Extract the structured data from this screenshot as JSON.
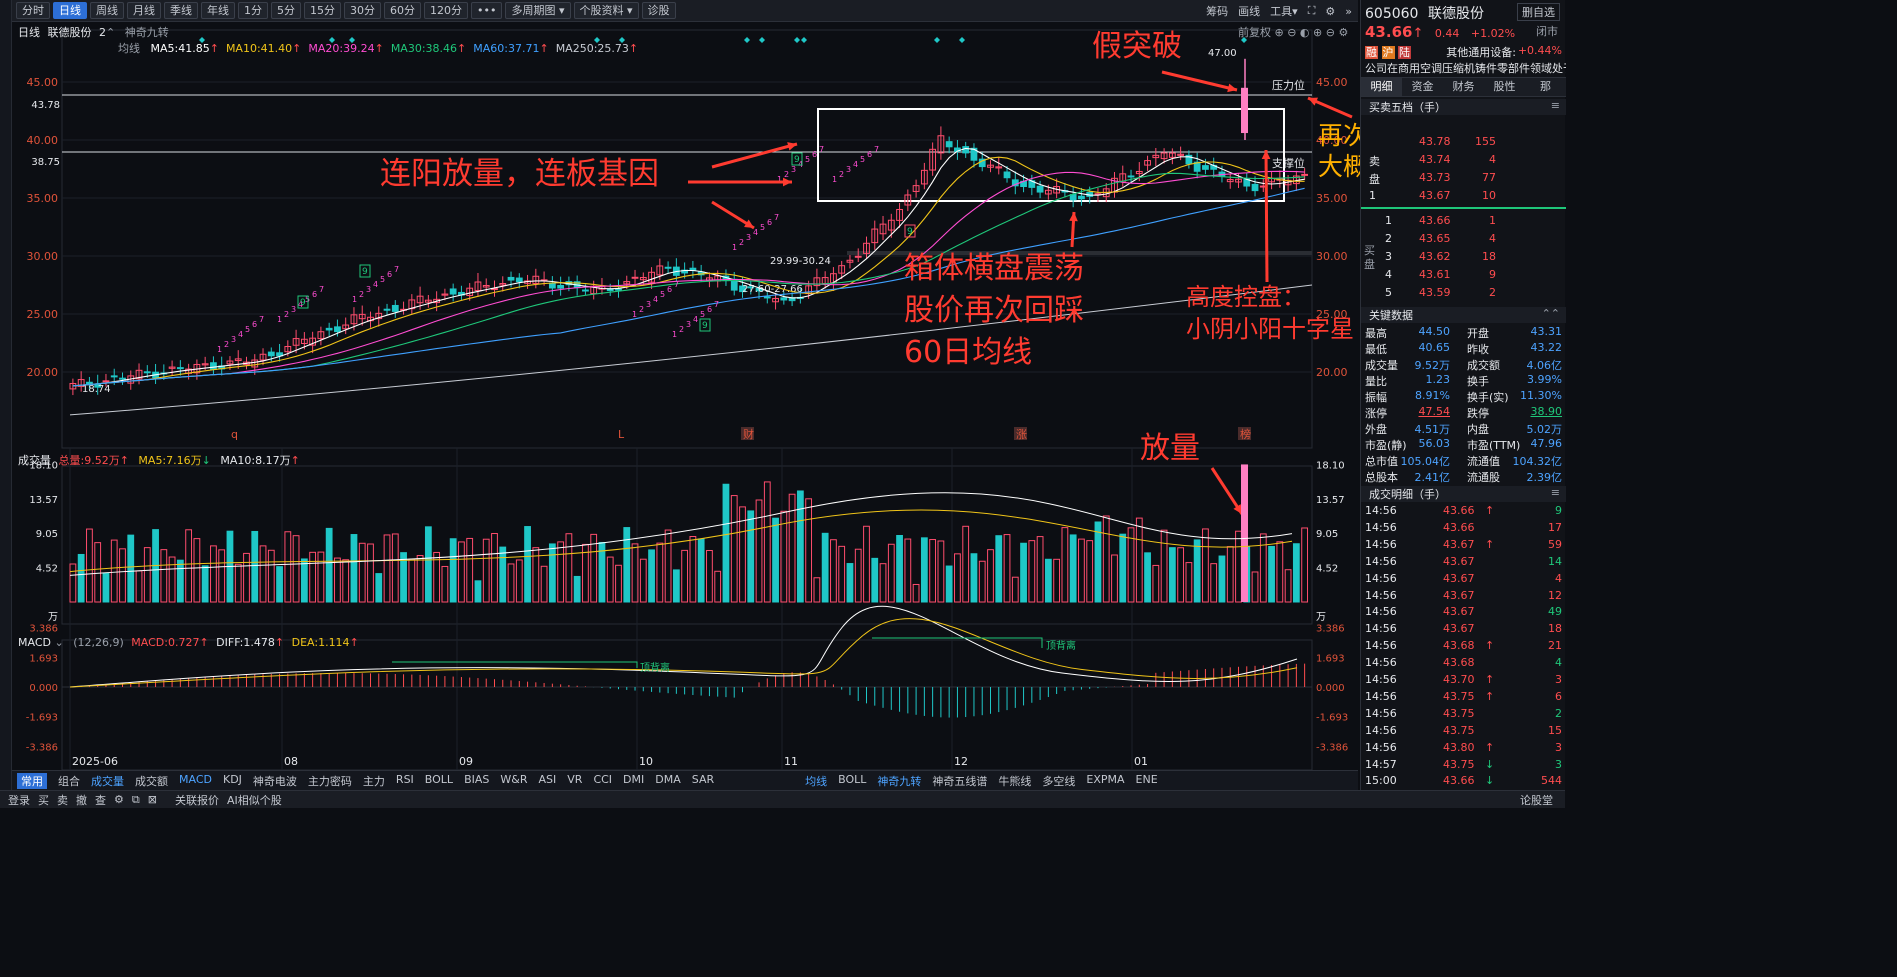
{
  "toolbar": {
    "periods": [
      "分时",
      "日线",
      "周线",
      "月线",
      "季线",
      "年线",
      "1分",
      "5分",
      "15分",
      "30分",
      "60分",
      "120分",
      "•••"
    ],
    "active": "日线",
    "multi": "多周期图",
    "info": "个股资料",
    "diag": "诊股",
    "tools": [
      "筹码",
      "画线",
      "工具"
    ]
  },
  "header": {
    "period": "日线",
    "stock": "联德股份",
    "count": "2",
    "indicator": "神奇九转",
    "fq": "前复权",
    "ma_label": "均线",
    "ma": [
      {
        "t": "MA5:41.85",
        "c": "#ffffff"
      },
      {
        "t": "MA10:41.40",
        "c": "#f0c419"
      },
      {
        "t": "MA20:39.24",
        "c": "#ff4dd2"
      },
      {
        "t": "MA30:38.46",
        "c": "#1fc77a"
      },
      {
        "t": "MA60:37.71",
        "c": "#3fa0ff"
      },
      {
        "t": "MA250:25.73",
        "c": "#c8ccd4"
      }
    ]
  },
  "yaxis": {
    "labels": [
      "45.00",
      "40.00",
      "35.00",
      "30.00",
      "25.00",
      "20.00"
    ],
    "left_ref1": "43.78",
    "left_ref2": "38.75",
    "hi": "47.00",
    "range1": "29.99-30.24",
    "range2": "27.60-27.66",
    "lo": "18.74",
    "press": "压力位",
    "support": "支撑位"
  },
  "xaxis": {
    "labels": [
      "2025-06",
      "08",
      "09",
      "10",
      "11",
      "12",
      "01"
    ]
  },
  "markers": {
    "q": "q",
    "L": "L",
    "cai": "财",
    "zhang": "涨",
    "bang": "榜"
  },
  "nine": {
    "digits": [
      "1",
      "2",
      "3",
      "4",
      "5",
      "6",
      "7",
      "8",
      "9"
    ]
  },
  "volume": {
    "label": "成交量",
    "total": "总量:9.52万",
    "ma5": "MA5:7.16万",
    "ma10": "MA10:8.17万",
    "ticks": [
      "18.10",
      "13.57",
      "9.05",
      "4.52",
      "万"
    ]
  },
  "macd": {
    "label": "MACD",
    "params": "(12,26,9)",
    "macd": "MACD:0.727",
    "diff": "DIFF:1.478",
    "dea": "DEA:1.114",
    "ticks": [
      "3.386",
      "1.693",
      "0.000",
      "-1.693",
      "-3.386"
    ],
    "div": "顶背离"
  },
  "indicators": {
    "tabs": [
      "常用",
      "组合",
      "成交量",
      "成交额",
      "MACD",
      "KDJ",
      "神奇电波",
      "主力密码",
      "主力",
      "RSI",
      "BOLL",
      "BIAS",
      "W&R",
      "ASI",
      "VR",
      "CCI",
      "DMI",
      "DMA",
      "SAR"
    ],
    "right": [
      "均线",
      "BOLL",
      "神奇九转",
      "神奇五线谱",
      "牛熊线",
      "多空线",
      "EXPMA",
      "ENE"
    ]
  },
  "status": {
    "items": [
      "登录",
      "买",
      "卖",
      "撤",
      "查"
    ],
    "tabs": [
      "关联报价",
      "AI相似个股"
    ],
    "right": "论股堂"
  },
  "annotations": {
    "a1": "假突破",
    "a2": "连阳放量，连板基因",
    "a3": "箱体横盘震荡",
    "a4": "股价再次回踩",
    "a5": "60日均线",
    "a6": "高度控盘：",
    "a7": "小阴小阳十字星",
    "a8": "再次放量逼近压力位",
    "a9": "大概率真突破",
    "a10": "放量"
  },
  "quote": {
    "code": "605060",
    "name": "联德股份",
    "btn": "删自选",
    "price": "43.66",
    "arrow": "↑",
    "chg": "0.44",
    "pct": "+1.02%",
    "status": "闭市",
    "tags": [
      "融",
      "沪",
      "陆"
    ],
    "sector": "其他通用设备:",
    "sector_pct": "+0.44%",
    "desc": "公司在商用空调压缩机铸件零部件领域处于..."
  },
  "rtabs": [
    "明细",
    "资金",
    "财务",
    "股性",
    "那"
  ],
  "book": {
    "title": "买卖五档（手）",
    "sell": [
      {
        "p": "",
        "v": ""
      },
      {
        "p": "43.78",
        "v": "155"
      },
      {
        "p": "43.74",
        "v": "4"
      },
      {
        "p": "43.73",
        "v": "77"
      },
      {
        "p": "43.67",
        "v": "10"
      }
    ],
    "sell_labels": [
      "",
      "",
      "卖",
      "盘",
      "1"
    ],
    "buy": [
      {
        "l": "1",
        "p": "43.66",
        "v": "1"
      },
      {
        "l": "2",
        "p": "43.65",
        "v": "4"
      },
      {
        "l": "3",
        "p": "43.62",
        "v": "18"
      },
      {
        "l": "4",
        "p": "43.61",
        "v": "9"
      },
      {
        "l": "5",
        "p": "43.59",
        "v": "2"
      }
    ],
    "buy_side": "买盘"
  },
  "keydata": {
    "title": "关键数据",
    "rows": [
      [
        "最高",
        "44.50",
        "开盘",
        "43.31"
      ],
      [
        "最低",
        "40.65",
        "昨收",
        "43.22"
      ],
      [
        "成交量",
        "9.52万",
        "成交额",
        "4.06亿"
      ],
      [
        "量比",
        "1.23",
        "换手",
        "3.99%"
      ],
      [
        "振幅",
        "8.91%",
        "换手(实)",
        "11.30%"
      ],
      [
        "涨停",
        "47.54",
        "跌停",
        "38.90"
      ],
      [
        "外盘",
        "4.51万",
        "内盘",
        "5.02万"
      ],
      [
        "市盈(静)",
        "56.03",
        "市盈(TTM)",
        "47.96"
      ],
      [
        "总市值",
        "105.04亿",
        "流通值",
        "104.32亿"
      ],
      [
        "总股本",
        "2.41亿",
        "流通股",
        "2.39亿"
      ]
    ]
  },
  "trades": {
    "title": "成交明细（手）",
    "rows": [
      [
        "14:56",
        "43.66",
        "↑",
        "9"
      ],
      [
        "14:56",
        "43.66",
        "",
        "17"
      ],
      [
        "14:56",
        "43.67",
        "↑",
        "59"
      ],
      [
        "14:56",
        "43.67",
        "",
        "14"
      ],
      [
        "14:56",
        "43.67",
        "",
        "4"
      ],
      [
        "14:56",
        "43.67",
        "",
        "12"
      ],
      [
        "14:56",
        "43.67",
        "",
        "49"
      ],
      [
        "14:56",
        "43.67",
        "",
        "18"
      ],
      [
        "14:56",
        "43.68",
        "↑",
        "21"
      ],
      [
        "14:56",
        "43.68",
        "",
        "4"
      ],
      [
        "14:56",
        "43.70",
        "↑",
        "3"
      ],
      [
        "14:56",
        "43.75",
        "↑",
        "6"
      ],
      [
        "14:56",
        "43.75",
        "",
        "2"
      ],
      [
        "14:56",
        "43.75",
        "",
        "15"
      ],
      [
        "14:56",
        "43.80",
        "↑",
        "3"
      ],
      [
        "14:57",
        "43.75",
        "↓",
        "3"
      ],
      [
        "15:00",
        "43.66",
        "↓",
        "544"
      ]
    ]
  }
}
